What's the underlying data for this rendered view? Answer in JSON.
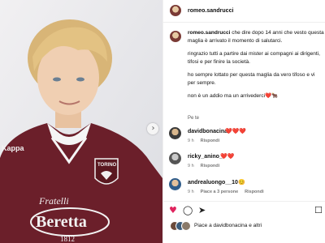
{
  "post": {
    "image_alt": "Young boy in a maroon Torino jersey with Beretta sponsor",
    "jersey": {
      "brand": "Kappa",
      "badge": "TORINO",
      "sponsor_top": "Fratelli",
      "sponsor_main": "Beretta",
      "sponsor_year": "1812"
    }
  },
  "header": {
    "username": "romeo.sandrucci"
  },
  "caption": {
    "username": "romeo.sandrucci",
    "line1_rest": "che dire dopo 14 anni che vesto questa",
    "line2": "maglia è arrivato il momento di salutarci.",
    "para2_line1": "ringrazio tutti a partire dai mister ai compagni ai dirigenti,",
    "para2_line2": "tifosi e per finire la società.",
    "para3_line1": "ho sempre lottato per questa maglia da vero tifoso e vi",
    "para3_line2": "per sempre.",
    "para4": "non è un addio ma un arrivederci❤️🐂",
    "see_translation": "Pe te"
  },
  "comments": [
    {
      "username": "davidbonacina",
      "text": "❤️❤️❤️",
      "time": "9 h",
      "likes": "",
      "reply": "Rispondi"
    },
    {
      "username": "ricky_anino_",
      "text": "❤️❤️",
      "time": "9 h",
      "likes": "",
      "reply": "Rispondi"
    },
    {
      "username": "andrealuongo__10",
      "text": "😊",
      "time": "9 h",
      "likes": "Piace a 3 persone",
      "reply": "Rispondi"
    }
  ],
  "actions": {
    "heart_icon": "heart-filled",
    "comment_icon": "comment",
    "share_icon": "send",
    "save_icon": "bookmark",
    "likes_text": "Piace a davidbonacina e altri"
  },
  "colors": {
    "jersey": "#6b1f2a",
    "heart": "#e0245e",
    "text": "#111111",
    "muted": "#777777"
  }
}
